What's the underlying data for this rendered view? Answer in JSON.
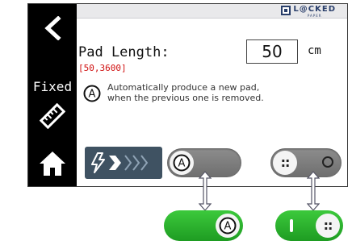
{
  "brand": {
    "name": "L@CKED",
    "sub": "PAPER"
  },
  "sidebar": {
    "mode_label": "Fixed"
  },
  "pad_length": {
    "label": "Pad Length:",
    "range": "[50,3600]",
    "value": "50",
    "unit": "cm"
  },
  "auto_option": {
    "text_line1": "Automatically produce a new pad,",
    "text_line2": "when the previous one is removed."
  },
  "icons": [
    "back-chevron-icon",
    "ruler-icon",
    "home-icon",
    "auto-a-icon",
    "lightning-icon",
    "feed-chevrons-icon"
  ],
  "colors": {
    "sidebar": "#000000",
    "feed_button": "#3f5262",
    "toggle_off": "#7a7a7a",
    "toggle_on": "#2bb12f",
    "range_text": "#d01010"
  },
  "toggles": {
    "auto_off": {
      "state": "off",
      "knob_letter": "A"
    },
    "manual_off": {
      "state": "off"
    },
    "auto_on": {
      "state": "on",
      "knob_letter": "A"
    },
    "manual_on": {
      "state": "on"
    }
  }
}
